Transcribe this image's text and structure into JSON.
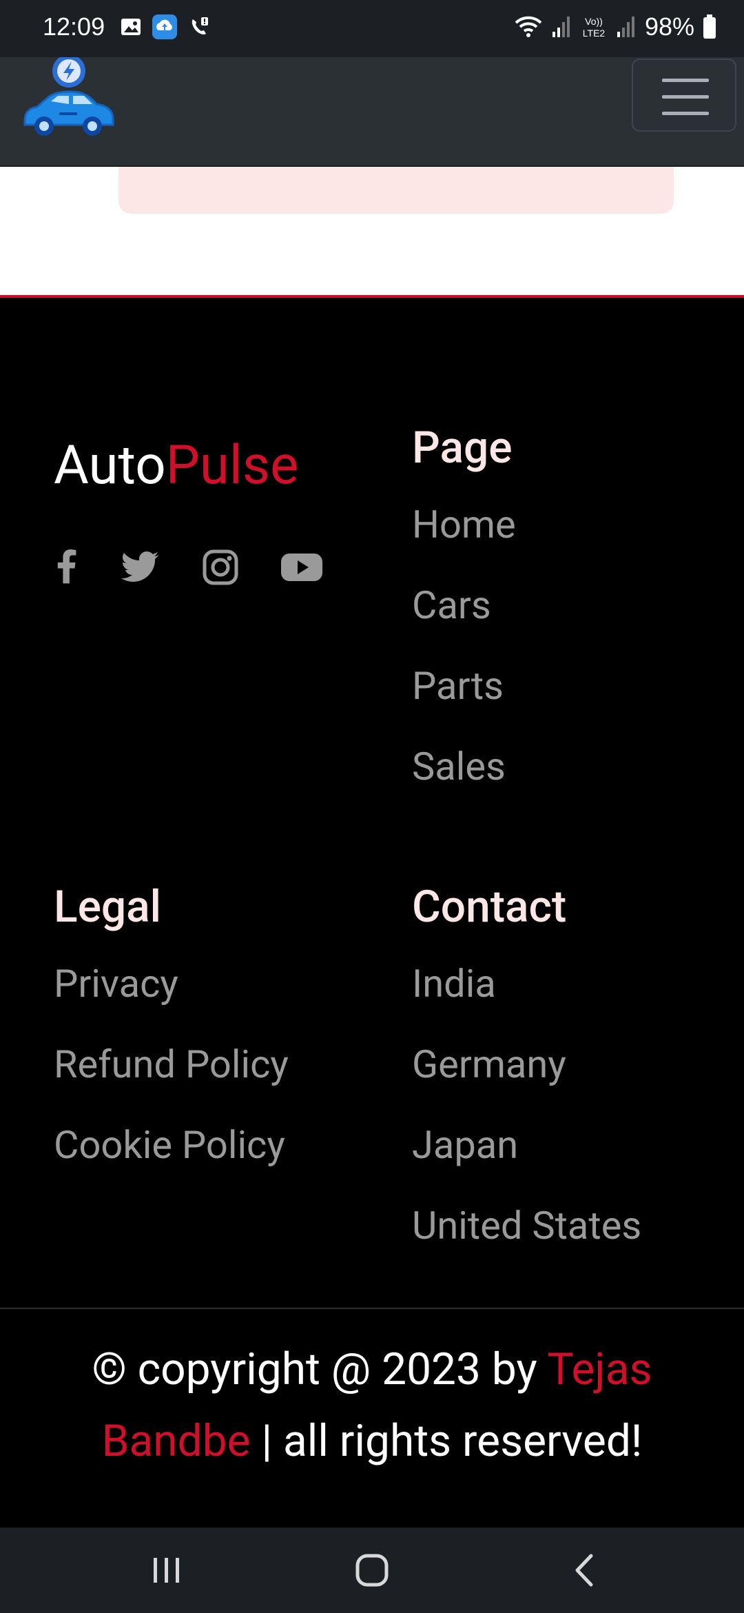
{
  "status_bar": {
    "time": "12:09",
    "battery": "98%"
  },
  "navbar": {
    "logo_icon": "electric-car-logo-icon",
    "menu_icon": "hamburger-menu-icon"
  },
  "footer": {
    "brand": {
      "part1": "Auto",
      "part2": "Pulse"
    },
    "social": [
      "facebook-icon",
      "twitter-icon",
      "instagram-icon",
      "youtube-icon"
    ],
    "page": {
      "heading": "Page",
      "links": [
        "Home",
        "Cars",
        "Parts",
        "Sales"
      ]
    },
    "legal": {
      "heading": "Legal",
      "links": [
        "Privacy",
        "Refund Policy",
        "Cookie Policy"
      ]
    },
    "contact": {
      "heading": "Contact",
      "links": [
        "India",
        "Germany",
        "Japan",
        "United States"
      ]
    },
    "copyright": {
      "before": "© copyright @ 2023 by ",
      "name": "Tejas Bandbe",
      "after": " | all rights reserved!"
    }
  },
  "colors": {
    "accent": "#d0102b",
    "heading": "#fde6e6",
    "link": "#9a9a9a",
    "navbar": "#2b3035"
  }
}
